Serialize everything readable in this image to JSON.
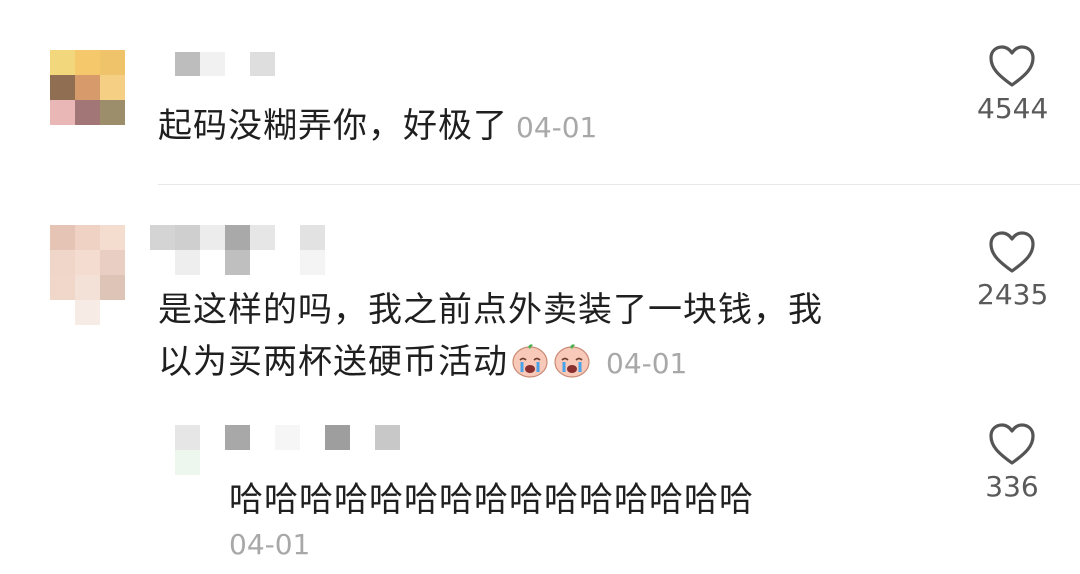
{
  "comments": [
    {
      "text": "起码没糊弄你，好极了",
      "date": "04-01",
      "likes": "4544",
      "avatar_colors": [
        "#f2d77c",
        "#f5c86b",
        "#efc36a",
        "#8f6e52",
        "#d79a6a",
        "#f5cf84",
        "#e8b7b6",
        "#a27676",
        "#9c8e6a"
      ]
    },
    {
      "text_line1": "是这样的吗，我之前点外卖装了一块钱，我",
      "text_line2": "以为买两杯送硬币活动",
      "emoji_name": "crying-face-emoji",
      "date": "04-01",
      "likes": "2435",
      "avatar_colors": [
        "#e6c4b5",
        "#f0d2c4",
        "#f4dccf",
        "#efd6c9",
        "#f4ddd0",
        "#e9cfc3",
        "#f1d7c9",
        "#f3e1d8",
        "#ddc4b6"
      ]
    },
    {
      "text": "哈哈哈哈哈哈哈哈哈哈哈哈哈哈哈",
      "date": "04-01",
      "likes": "336"
    }
  ],
  "icons": {
    "like": "heart-outline-icon"
  },
  "colors": {
    "text": "#1f1f1f",
    "date": "#a8a8a8",
    "likes": "#5a5a5a",
    "divider": "#e8e8e8"
  }
}
